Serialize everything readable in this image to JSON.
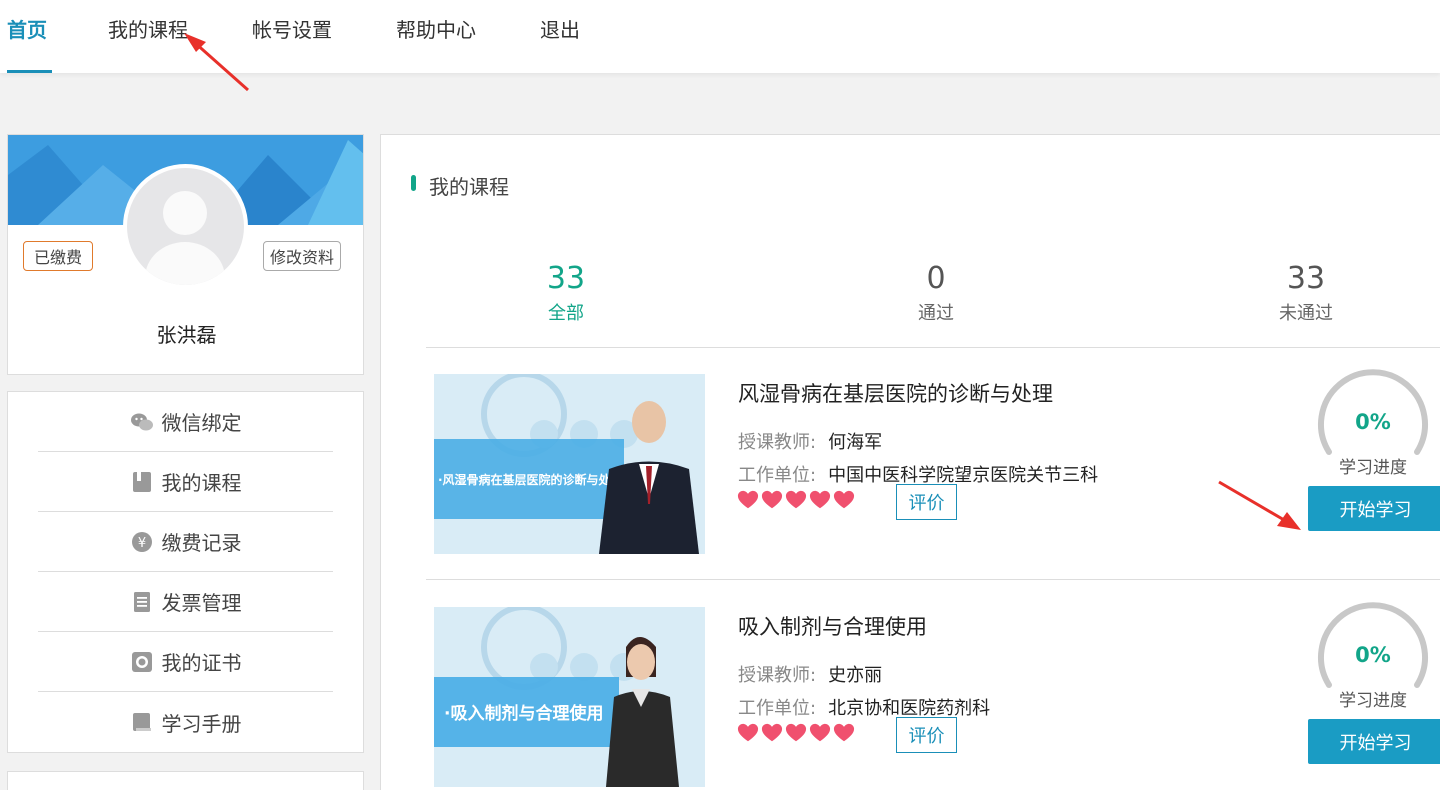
{
  "nav": {
    "items": [
      "首页",
      "我的课程",
      "帐号设置",
      "帮助中心",
      "退出"
    ],
    "active_index": 0
  },
  "profile": {
    "paid_tag": "已缴费",
    "edit_tag": "修改资料",
    "name": "张洪磊"
  },
  "side_menu": [
    {
      "label": "微信绑定",
      "icon": "wechat-icon"
    },
    {
      "label": "我的课程",
      "icon": "book-icon"
    },
    {
      "label": "缴费记录",
      "icon": "yen-icon"
    },
    {
      "label": "发票管理",
      "icon": "document-icon"
    },
    {
      "label": "我的证书",
      "icon": "certificate-icon"
    },
    {
      "label": "学习手册",
      "icon": "manual-icon"
    }
  ],
  "main": {
    "section_title": "我的课程",
    "stats": [
      {
        "num": "33",
        "label": "全部"
      },
      {
        "num": "0",
        "label": "通过"
      },
      {
        "num": "33",
        "label": "未通过"
      }
    ],
    "teacher_key": "授课教师:",
    "unit_key": "工作单位:",
    "rate_label": "评价",
    "progress_label": "学习进度",
    "start_label": "开始学习",
    "courses": [
      {
        "title": "风湿骨病在基层医院的诊断与处理",
        "teacher": "何海军",
        "unit": "中国中医科学院望京医院关节三科",
        "thumb_text": "·风湿骨病在基层医院的诊断与处理",
        "rating": 5,
        "progress": "0%",
        "progress_fraction": 0
      },
      {
        "title": "吸入制剂与合理使用",
        "teacher": "史亦丽",
        "unit": "北京协和医院药剂科",
        "thumb_text": "·吸入制剂与合理使用",
        "rating": 5,
        "progress": "0%",
        "progress_fraction": 0
      }
    ]
  },
  "colors": {
    "accent": "#1a8fb8",
    "green": "#12a589",
    "start_button": "#1a9cc4",
    "heart": "#f0506e",
    "arrow": "#e8302a"
  }
}
